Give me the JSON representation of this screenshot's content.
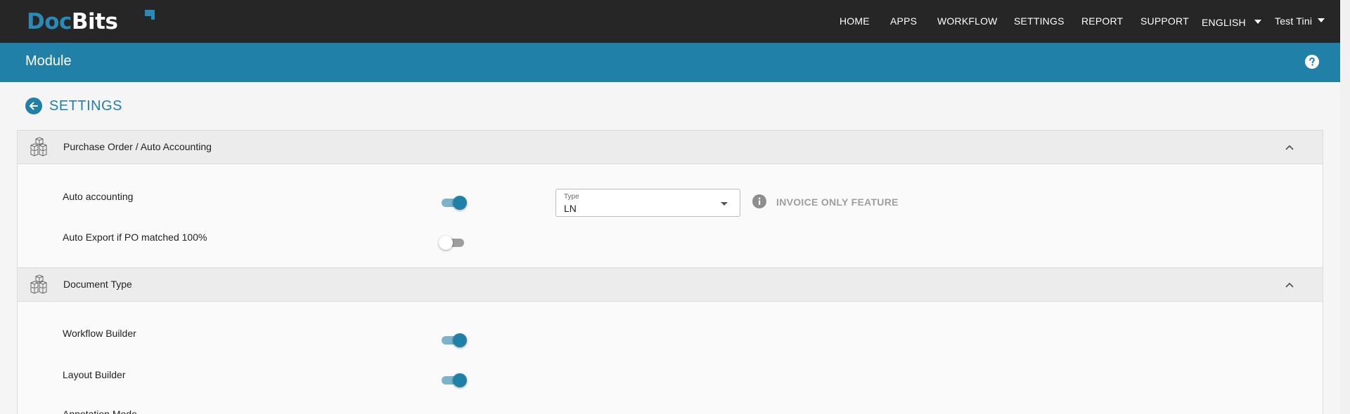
{
  "logo": {
    "part1": "Doc",
    "part2": "Bits"
  },
  "nav": {
    "items": [
      "HOME",
      "APPS",
      "WORKFLOW",
      "SETTINGS",
      "REPORT",
      "SUPPORT"
    ],
    "language": "ENGLISH",
    "user": "Test Tini"
  },
  "module": {
    "title": "Module"
  },
  "settings": {
    "title": "SETTINGS"
  },
  "panels": [
    {
      "title": "Purchase Order / Auto Accounting",
      "rows": [
        {
          "label": "Auto accounting",
          "enabled": true
        },
        {
          "label": "Auto Export if PO matched 100%",
          "enabled": false
        }
      ],
      "type_select": {
        "label": "Type",
        "value": "LN"
      },
      "info": "INVOICE ONLY FEATURE"
    },
    {
      "title": "Document Type",
      "rows": [
        {
          "label": "Workflow Builder",
          "enabled": true
        },
        {
          "label": "Layout Builder",
          "enabled": true
        },
        {
          "label": "Annotation Mode",
          "enabled": false
        }
      ]
    }
  ],
  "colors": {
    "accent": "#2180a7",
    "topbar": "#262626",
    "toggle_track_on": "#7ab3cb"
  }
}
